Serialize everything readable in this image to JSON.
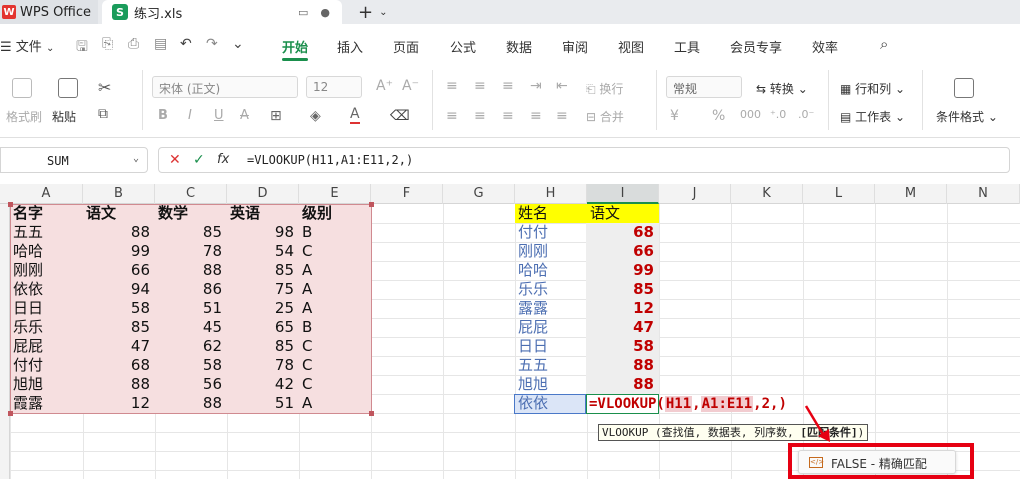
{
  "tabs": {
    "home_label": "WPS Office",
    "file_label": "练习.xls",
    "home_logo": "W",
    "file_logo": "S",
    "add_label": "+"
  },
  "menu": {
    "file_label": "文件",
    "tabs": [
      "开始",
      "插入",
      "页面",
      "公式",
      "数据",
      "审阅",
      "视图",
      "工具",
      "会员专享",
      "效率"
    ],
    "active_tab": "开始"
  },
  "ribbon": {
    "format_painter": "格式刷",
    "paste": "粘贴",
    "font_name": "宋体 (正文)",
    "font_size": "12",
    "number_format": "常规",
    "convert": "转换",
    "rows_cols": "行和列",
    "worksheet": "工作表",
    "cond_format": "条件格式",
    "wrap": "换行",
    "merge": "合并"
  },
  "formula_bar": {
    "name_box": "SUM",
    "fx_label": "fx",
    "formula": "=VLOOKUP(H11,A1:E11,2,)"
  },
  "columns": [
    "A",
    "B",
    "C",
    "D",
    "E",
    "F",
    "G",
    "H",
    "I",
    "J",
    "K",
    "L",
    "M",
    "N"
  ],
  "table_left": {
    "headers": [
      "名字",
      "语文",
      "数学",
      "英语",
      "级别"
    ],
    "rows": [
      [
        "五五",
        "88",
        "85",
        "98",
        "B"
      ],
      [
        "哈哈",
        "99",
        "78",
        "54",
        "C"
      ],
      [
        "刚刚",
        "66",
        "88",
        "85",
        "A"
      ],
      [
        "依依",
        "94",
        "86",
        "75",
        "A"
      ],
      [
        "日日",
        "58",
        "51",
        "25",
        "A"
      ],
      [
        "乐乐",
        "85",
        "45",
        "65",
        "B"
      ],
      [
        "屁屁",
        "47",
        "62",
        "85",
        "C"
      ],
      [
        "付付",
        "68",
        "58",
        "78",
        "C"
      ],
      [
        "旭旭",
        "88",
        "56",
        "42",
        "C"
      ],
      [
        "霞露",
        "12",
        "88",
        "51",
        "A"
      ]
    ]
  },
  "table_right": {
    "headers": [
      "姓名",
      "语文"
    ],
    "rows": [
      [
        "付付",
        "68"
      ],
      [
        "刚刚",
        "66"
      ],
      [
        "哈哈",
        "99"
      ],
      [
        "乐乐",
        "85"
      ],
      [
        "露露",
        "12"
      ],
      [
        "屁屁",
        "47"
      ],
      [
        "日日",
        "58"
      ],
      [
        "五五",
        "88"
      ],
      [
        "旭旭",
        "88"
      ]
    ],
    "lookup_name": "依依"
  },
  "formula_edit": {
    "prefix": "=VLOOKUP(",
    "ref1": "H11",
    "comma1": ",",
    "ref2": "A1:E11",
    "suffix": ",2,)"
  },
  "tooltip": {
    "prefix": "VLOOKUP (查找值, 数据表, 列序数, ",
    "bold_part": "[匹配条件]",
    "suffix": ")"
  },
  "dropdown": {
    "icon_text": "</>",
    "option": "FALSE - 精确匹配"
  },
  "colors": {
    "accent": "#1a8f4c",
    "highlight_red": "#e60012",
    "yellow": "#ffff00",
    "range_fill": "#f6dfe0",
    "blue_text": "#4d6fb2",
    "red_text": "#c00000"
  }
}
